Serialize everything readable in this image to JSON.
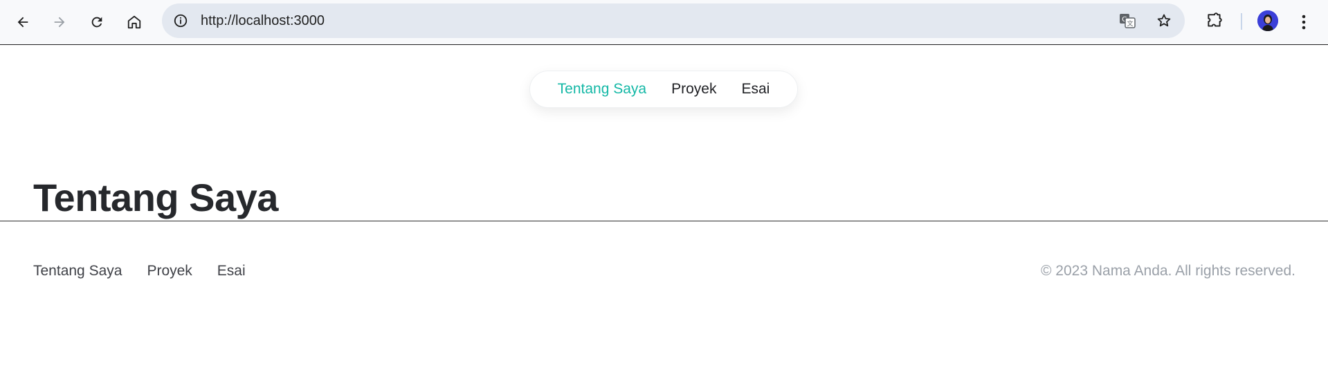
{
  "browser": {
    "url": "http://localhost:3000",
    "icons": {
      "back": "back-arrow-icon",
      "forward": "forward-arrow-icon",
      "reload": "reload-icon",
      "home": "home-icon",
      "info": "site-info-icon",
      "translate": "translate-icon",
      "bookmark": "bookmark-star-icon",
      "extensions": "extensions-puzzle-icon",
      "profile": "profile-avatar",
      "menu": "kebab-menu-icon"
    }
  },
  "header_nav": {
    "items": [
      {
        "label": "Tentang Saya",
        "active": true
      },
      {
        "label": "Proyek",
        "active": false
      },
      {
        "label": "Esai",
        "active": false
      }
    ]
  },
  "main": {
    "title": "Tentang Saya"
  },
  "footer": {
    "links": [
      "Tentang Saya",
      "Proyek",
      "Esai"
    ],
    "copyright": "© 2023 Nama Anda. All rights reserved."
  },
  "colors": {
    "accent": "#14b8a6",
    "text_dark": "#26282c",
    "muted": "#9aa0a8"
  }
}
